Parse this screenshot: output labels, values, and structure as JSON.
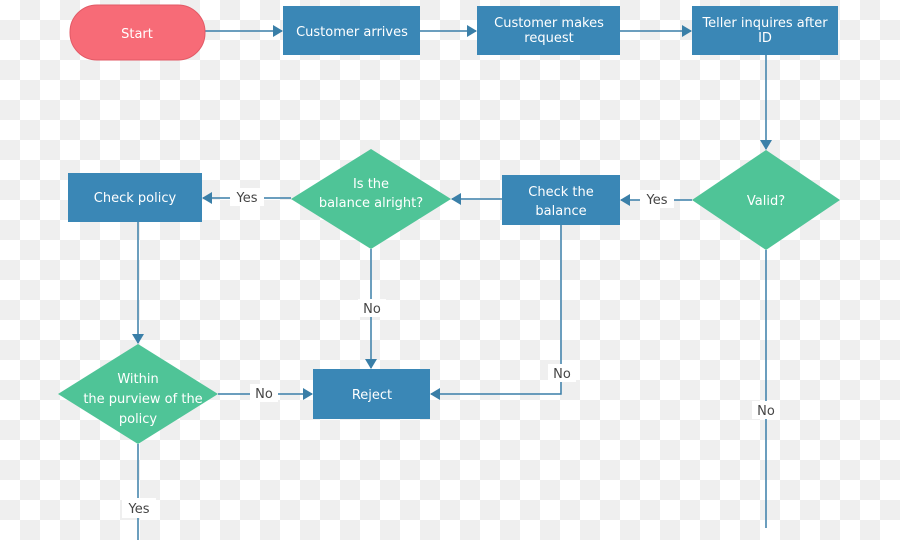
{
  "colors": {
    "start": "#f76b77",
    "process": "#3a87b6",
    "decision": "#4fc497",
    "edge": "#3a7fa8"
  },
  "nodes": {
    "start": "Start",
    "customer_arrives": "Customer arrives",
    "customer_request": [
      "Customer makes",
      "request"
    ],
    "teller": [
      "Teller inquires after",
      "ID"
    ],
    "valid": "Valid?",
    "check_balance": [
      "Check the",
      "balance"
    ],
    "balance_alright": [
      "Is the",
      "balance  alright?"
    ],
    "check_policy": "Check policy",
    "within_policy": [
      "Within",
      "the purview  of the",
      "policy"
    ],
    "reject": "Reject"
  },
  "edge_labels": {
    "valid_yes": "Yes",
    "valid_no": "No",
    "balance_yes": "Yes",
    "balance_no": "No",
    "check_balance_no": "No",
    "policy_no": "No",
    "policy_yes": "Yes"
  }
}
